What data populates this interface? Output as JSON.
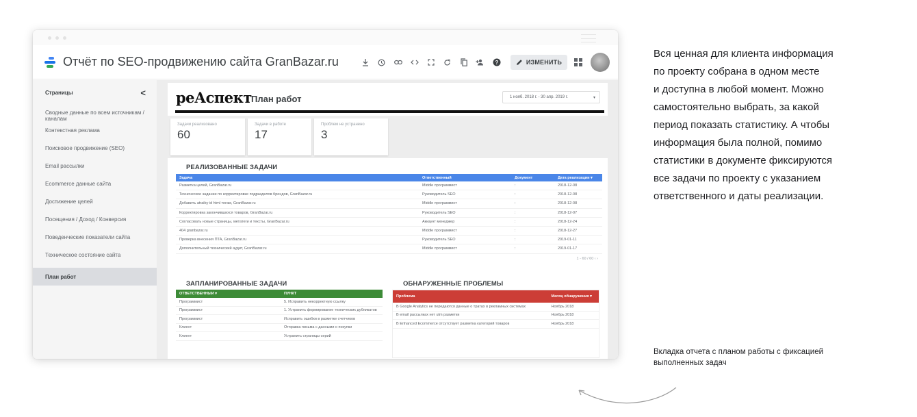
{
  "window": {
    "title": "Отчёт по SEO-продвижению сайта GranBazar.ru",
    "edit_label": "ИЗМЕНИТЬ",
    "toolbar_icons": [
      "download-icon",
      "history-icon",
      "link-icon",
      "embed-icon",
      "fullscreen-icon",
      "refresh-icon",
      "copy-icon",
      "share-icon",
      "help-icon"
    ]
  },
  "sidebar": {
    "title": "Страницы",
    "collapse_glyph": "<",
    "items": [
      {
        "label": "Сводные данные по всем источникам / каналам"
      },
      {
        "label": "Контекстная реклама"
      },
      {
        "label": "Поисковое продвижение (SEO)"
      },
      {
        "label": "Email рассылки"
      },
      {
        "label": "Ecommerce данные сайта"
      },
      {
        "label": "Достижение целей"
      },
      {
        "label": "Посещения / Доход / Конверсия"
      },
      {
        "label": "Поведенческие показатели сайта"
      },
      {
        "label": "Техническое состояние сайта"
      },
      {
        "label": "План работ",
        "active": true
      }
    ]
  },
  "report": {
    "brand": "реАспект",
    "title": "План работ",
    "date_range": "1 нояб. 2018 г. - 30 апр. 2019 г.",
    "date_range_chevron": "▾",
    "kpis": [
      {
        "label": "Задачи реализовано",
        "value": "60"
      },
      {
        "label": "Задачи в работе",
        "value": "17"
      },
      {
        "label": "Проблем не устранено",
        "value": "3"
      }
    ],
    "done_section": {
      "title": "РЕАЛИЗОВАННЫЕ ЗАДАЧИ",
      "color": "#4a86e8",
      "headers": [
        "Задача",
        "Ответственный",
        "Документ",
        "Дата реализации ▾"
      ],
      "rows": [
        [
          "Разметка целей, GranBazar.ru",
          "Middle программист",
          ":",
          "2018-12-08"
        ],
        [
          "Техническое задание по корректировке подразделов брендов, GranBazar.ru",
          "Руководитель SEO",
          ":",
          "2018-12-08"
        ],
        [
          "Добавить atraiby id html тегам, GranBazar.ru",
          "Middle программист",
          ":",
          "2018-12-08"
        ],
        [
          "Корректировка закончившихся товаров, GranBazar.ru",
          "Руководитель SEO",
          ":",
          "2018-12-07"
        ],
        [
          "Согласовать новые страницы, метатеги и тексты, GranBazar.ru",
          "Аккаунт менеджер",
          ":",
          "2018-12-24"
        ],
        [
          "404 granbazar.ru",
          "Middle программист",
          ":",
          "2018-12-27"
        ],
        [
          "Проверка внесения ПТА, GranBazar.ru",
          "Руководитель SEO",
          ":",
          "2019-01-11"
        ],
        [
          "Дополнительный технический аудит, GranBazar.ru",
          "Middle программист",
          ":",
          "2019-01-17"
        ]
      ],
      "pager": "1 - 60 / 60   ‹   ›"
    },
    "planned_section": {
      "title": "ЗАПЛАНИРОВАННЫЕ ЗАДАЧИ",
      "color": "#3d8b37",
      "headers": [
        "ОТВЕТСТВЕННЫЙ ▾",
        "ПУНКТ"
      ],
      "rows": [
        [
          "Программист",
          "5. Исправить некорректную ссылку"
        ],
        [
          "Программист",
          "1. Устранить формирование технических дубликатов"
        ],
        [
          "Программист",
          "Исправить ошибки в разметке счетчиков"
        ],
        [
          "Клиент",
          "Отправка письма с данными о покупки"
        ],
        [
          "Клиент",
          "Устранить страницы серий"
        ]
      ]
    },
    "issues_section": {
      "title": "ОБНАРУЖЕННЫЕ ПРОБЛЕМЫ",
      "color": "#cc3d36",
      "headers": [
        "Проблема",
        "Месяц обнаружения ▾"
      ],
      "rows": [
        [
          "В Google Analytics не передаются данные о тратах в рекламных системах",
          "Ноябрь 2018"
        ],
        [
          "В email рассылках нет utm разметки",
          "Ноябрь 2018"
        ],
        [
          "В Enhanced Ecommerce отсутствует разметка категорий товаров",
          "Ноябрь 2018"
        ]
      ]
    }
  },
  "side_text": {
    "lines": [
      "Вся ценная для клиента информация",
      "по проекту собрана в одном месте",
      "и доступна в любой момент. Можно",
      "самостоятельно выбрать, за какой",
      "период показать статистику. А чтобы",
      "информация была полной, помимо",
      "статистики в документе фиксируются",
      "все задачи по проекту с указанием",
      "ответственного и даты реализации."
    ]
  },
  "caption": {
    "line1": "Вкладка отчета с планом работы с фиксацией",
    "line2": "выполненных задач"
  }
}
